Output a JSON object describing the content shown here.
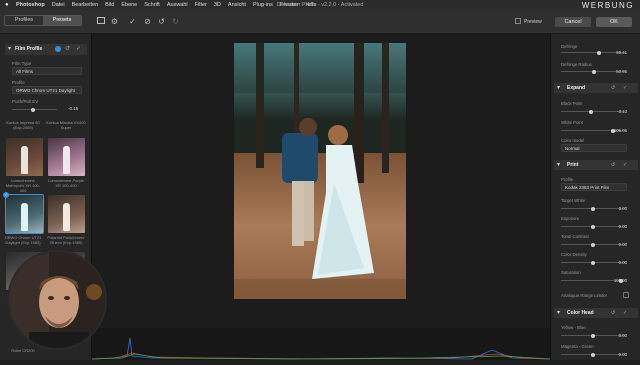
{
  "menubar": {
    "apple": "",
    "items": [
      "Photoshop",
      "Datei",
      "Bearbeiten",
      "Bild",
      "Ebene",
      "Schrift",
      "Auswahl",
      "Filter",
      "3D",
      "Ansicht",
      "Plug-ins",
      "Fenster",
      "Hilfe"
    ],
    "window_title": "Dehancer Photo - v2.2.0 - Activated",
    "watermark": "WERBUNG"
  },
  "toolbar": {
    "tabs": [
      "Profiles",
      "Presets"
    ],
    "active_tab": "Presets",
    "preview_label": "Preview",
    "cancel_label": "Cancel",
    "ok_label": "OK"
  },
  "left": {
    "film_profile": {
      "title": "Film Profile",
      "film_type_label": "Film Type",
      "film_type_value": "All Films",
      "profile_label": "Profile",
      "profile_value": "ORWO Chrom UT21 Daylight",
      "push_pull_label": "Push/Pull EV",
      "push_pull_value": "-0.15",
      "push_pull_level": 0.47
    },
    "thumbnails": [
      {
        "caption": "Konica Impresa 50 (Exp.2009)"
      },
      {
        "caption": "Konica Minolta VX400 Super"
      },
      {
        "caption": "Lomochrome Metropolis XR 100-400"
      },
      {
        "caption": "Lomochrome Purple XR 100-400"
      },
      {
        "caption": "ORWO Chrom UT21 Daylight (Exp.1983)"
      },
      {
        "caption": "Polaroid Polachrome 35 mm (Exp.1989)"
      },
      {
        "caption": "Rollei CR200"
      },
      {
        "caption": ""
      }
    ]
  },
  "right": {
    "top_rows": [
      {
        "label": "Defringe",
        "value": "59.41",
        "level": 0.59
      },
      {
        "label": "Defringe Radius",
        "value": "50.95",
        "level": 0.51
      }
    ],
    "expand": {
      "title": "Expand",
      "rows": [
        {
          "label": "Black Point",
          "value": "-3.13",
          "level": 0.47
        },
        {
          "label": "White Point",
          "value": "106.06",
          "level": 0.82
        }
      ],
      "color_model_label": "Color model",
      "color_model_value": "Normal"
    },
    "print": {
      "title": "Print",
      "profile_label": "Profile",
      "profile_value": "Kodak 2383 Print Film",
      "rows": [
        {
          "label": "Target White",
          "value": "0.00",
          "level": 0.5
        },
        {
          "label": "Exposure",
          "value": "0.00",
          "level": 0.5
        },
        {
          "label": "Tonal Contrast",
          "value": "0.00",
          "level": 0.5
        },
        {
          "label": "Color Density",
          "value": "0.00",
          "level": 0.5
        },
        {
          "label": "Saturation",
          "value": "100.00",
          "level": 0.93
        }
      ],
      "analogue_range_label": "Analogue Range Limiter"
    },
    "color_head": {
      "title": "Color Head",
      "rows": [
        {
          "label": "Yellow - Blue",
          "value": "0.00",
          "level": 0.5
        },
        {
          "label": "Magenta - Green",
          "value": "0.00",
          "level": 0.5
        }
      ]
    }
  },
  "colors": {
    "accent": "#3a8fd9",
    "ok_button": "#5a5a5a",
    "cancel_button": "#4a4a4a"
  }
}
